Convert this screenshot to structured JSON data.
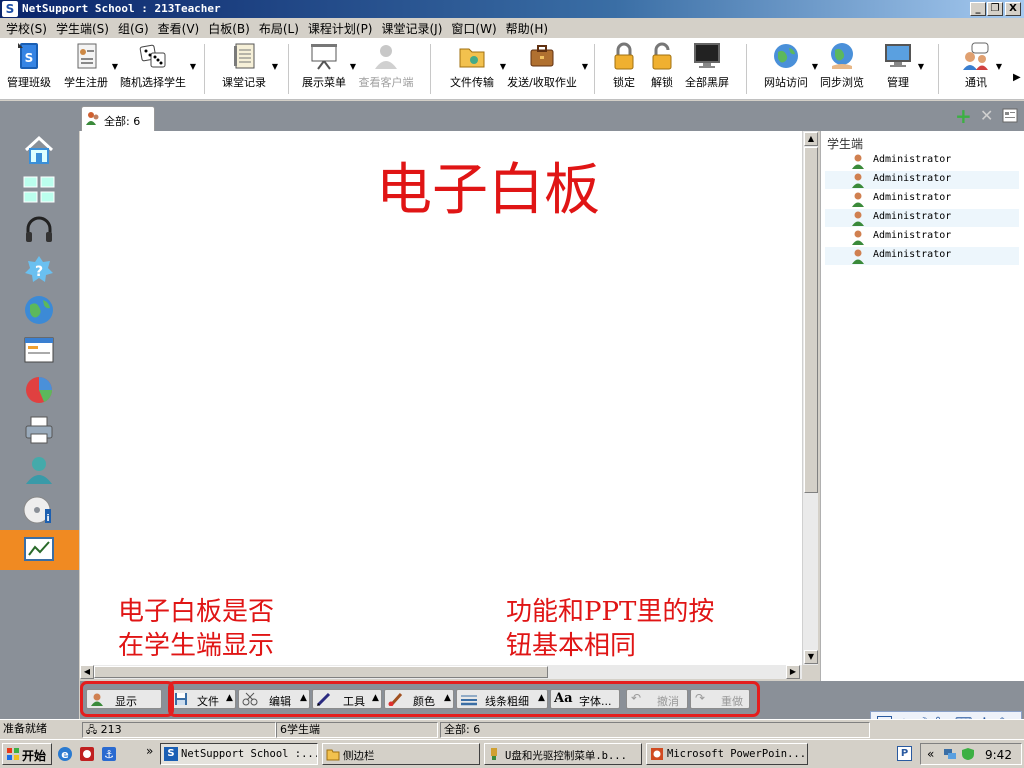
{
  "window": {
    "title": "NetSupport School : 213Teacher",
    "app_icon_letter": "S",
    "btn_minimize": "_",
    "btn_restore": "❐",
    "btn_close": "X"
  },
  "menu": [
    "学校(S)",
    "学生端(S)",
    "组(G)",
    "查看(V)",
    "白板(B)",
    "布局(L)",
    "课程计划(P)",
    "课堂记录(J)",
    "窗口(W)",
    "帮助(H)"
  ],
  "toolbar": {
    "manage_class": "管理班级",
    "student_register": "学生注册",
    "random_select": "随机选择学生",
    "class_record": "课堂记录",
    "show_menu": "展示菜单",
    "view_client": "查看客户端",
    "file_transfer": "文件传输",
    "send_collect": "发送/收取作业",
    "lock": "锁定",
    "unlock": "解锁",
    "blackscreen": "全部黑屏",
    "web_access": "网站访问",
    "sync_browse": "同步浏览",
    "manage": "管理",
    "comm": "通讯",
    "more_arrow": "▶"
  },
  "tab": {
    "label": "全部: 6"
  },
  "board": {
    "title": "电子白板",
    "note_left_1": "电子白板是否",
    "note_left_2": "在学生端显示",
    "note_right_1": "功能和PPT里的按",
    "note_right_2": "钮基本相同"
  },
  "student_panel": {
    "header": "学生端",
    "students": [
      "Administrator",
      "Administrator",
      "Administrator",
      "Administrator",
      "Administrator",
      "Administrator"
    ]
  },
  "wb_toolbar": {
    "show": "显示",
    "file": "文件",
    "edit": "编辑",
    "tools": "工具",
    "color": "颜色",
    "line_width": "线条粗细",
    "font": "字体...",
    "undo": "撤消",
    "redo": "重做",
    "dropdown_arrow": "▲"
  },
  "statusbar": {
    "ready": "准备就绪",
    "computer": "213",
    "students": "6学生端",
    "all": "全部: 6"
  },
  "taskbar": {
    "start": "开始",
    "chevron": "»",
    "tasks": [
      "NetSupport School :...",
      "侧边栏",
      "U盘和光驱控制菜单.b...",
      "Microsoft PowerPoin..."
    ],
    "tray_chevron": "«",
    "clock": "9:42"
  },
  "ime": {
    "label": "中"
  },
  "colors": {
    "accent_red": "#e01515",
    "sidebar_gray": "#8a9098",
    "active_orange": "#f08a22"
  }
}
